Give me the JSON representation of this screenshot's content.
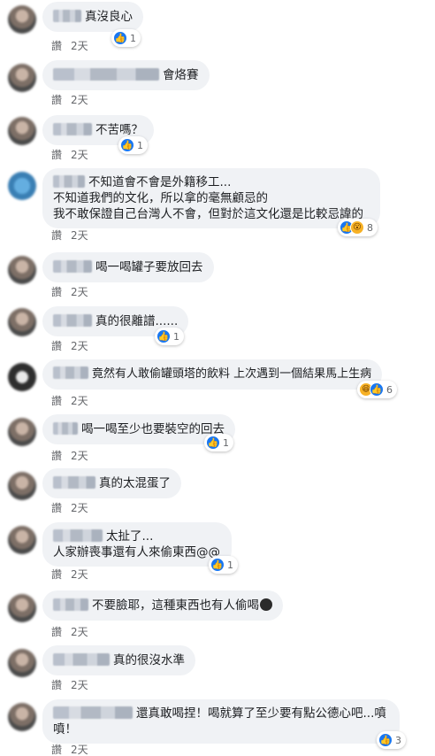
{
  "comments": [
    {
      "text": "真沒良心",
      "like": "讚",
      "time": "2天",
      "reaction_count": "1"
    },
    {
      "text": "會烙賽",
      "like": "讚",
      "time": "2天"
    },
    {
      "text": "不苦嗎？",
      "like": "讚",
      "time": "2天",
      "reaction_count": "1"
    },
    {
      "line1": "不知道會不會是外籍移工...",
      "line2": "不知道我們的文化，所以拿的毫無顧忌的",
      "line3": "我不敢保證自己台灣人不會，但對於這文化還是比較忌諱的",
      "like": "讚",
      "time": "2天",
      "reaction_count": "8"
    },
    {
      "text": "喝一喝罐子要放回去",
      "like": "讚",
      "time": "2天"
    },
    {
      "text": "真的很離譜......",
      "like": "讚",
      "time": "2天",
      "reaction_count": "1"
    },
    {
      "text": "竟然有人敢偷罐頭塔的飲料 上次遇到一個結果馬上生病",
      "like": "讚",
      "time": "2天",
      "reaction_count": "6"
    },
    {
      "text": "喝一喝至少也要裝空的回去",
      "like": "讚",
      "time": "2天",
      "reaction_count": "1"
    },
    {
      "text": "真的太混蛋了",
      "like": "讚",
      "time": "2天"
    },
    {
      "line1": "太扯了...",
      "line2": "人家辦喪事還有人來偷東西@@",
      "like": "讚",
      "time": "2天",
      "reaction_count": "1"
    },
    {
      "text": "不要臉耶，這種東西也有人偷喝",
      "like": "讚",
      "time": "2天"
    },
    {
      "text": "真的很沒水準",
      "like": "讚",
      "time": "2天"
    },
    {
      "line1": "還真敢喝捏！喝就算了至少要有點公德心吧...噴",
      "line2": "噴！",
      "like": "讚",
      "time": "2天",
      "reaction_count": "3"
    }
  ],
  "icons": {
    "like": "thumbs-up-icon",
    "haha": "haha-icon",
    "wow": "wow-icon"
  },
  "colors": {
    "bubble": "#f0f2f5",
    "meta": "#65676b",
    "like": "#1877f2"
  }
}
